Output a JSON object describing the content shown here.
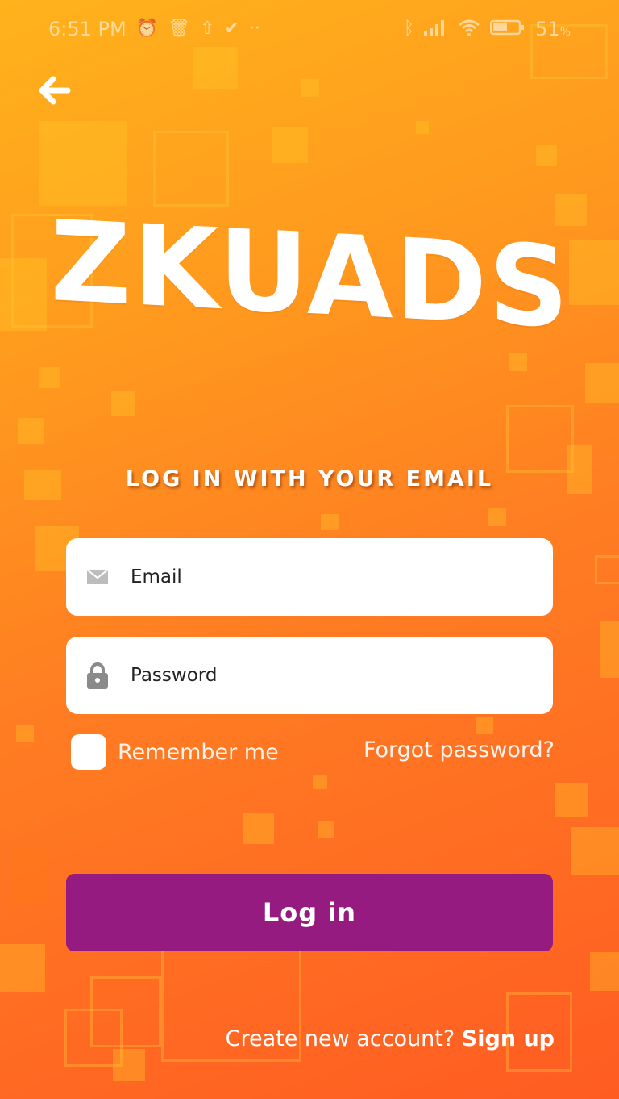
{
  "status_bar": {
    "time": "6:51 PM",
    "battery": "51",
    "battery_unit": "%",
    "icons": [
      "alarm-icon",
      "trash-icon",
      "upload-icon",
      "check-circle-icon",
      "more-dots-icon",
      "bluetooth-icon",
      "signal-icon",
      "wifi-icon",
      "battery-icon"
    ]
  },
  "nav": {
    "back_icon": "arrow-left-icon"
  },
  "logo": {
    "text": "ZKUADS"
  },
  "heading": "LOG IN WITH YOUR EMAIL",
  "form": {
    "email_placeholder": "Email",
    "email_icon": "envelope-icon",
    "password_placeholder": "Password",
    "password_icon": "lock-icon",
    "remember_label": "Remember me",
    "forgot_label": "Forgot password?",
    "login_label": "Log in"
  },
  "footer": {
    "prompt": "Create new account?",
    "signup_label": "Sign up"
  },
  "colors": {
    "background_top": "#ffb21c",
    "background_bottom": "#ff5c22",
    "button": "#951b81",
    "field": "#ffffff"
  }
}
